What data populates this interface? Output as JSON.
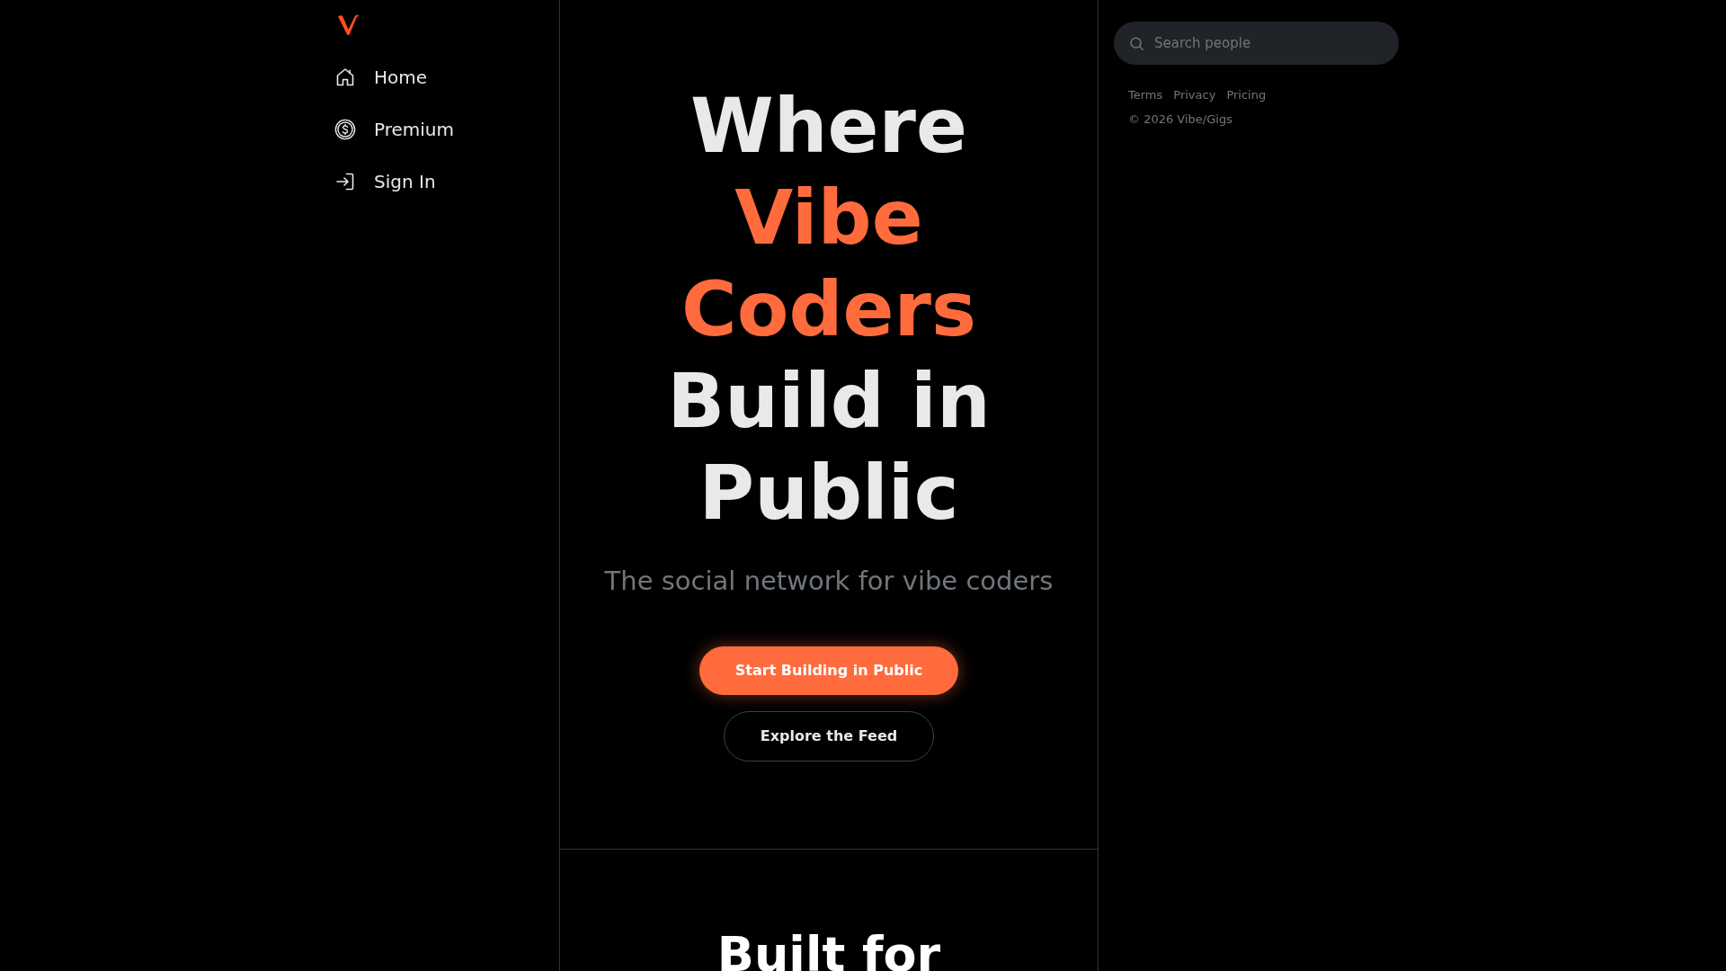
{
  "sidebar": {
    "items": [
      {
        "label": "Home"
      },
      {
        "label": "Premium"
      },
      {
        "label": "Sign In"
      }
    ]
  },
  "hero": {
    "heading": [
      {
        "text": "Where",
        "highlighted": false
      },
      {
        "text": "Vibe Coders",
        "highlighted": true
      },
      {
        "text": "Build in Public",
        "highlighted": false
      }
    ],
    "subtitle": "The social network for vibe coders",
    "buttons": [
      {
        "label": "Start Building in Public",
        "kind": "primary"
      },
      {
        "label": "Explore the Feed",
        "kind": "outline"
      }
    ]
  },
  "features": {
    "heading": "Built for"
  },
  "search": {
    "placeholder": "Search people"
  },
  "footer": {
    "links": [
      "Terms",
      "Privacy",
      "Pricing"
    ],
    "copyright": "© 2026 Vibe/Gigs"
  }
}
